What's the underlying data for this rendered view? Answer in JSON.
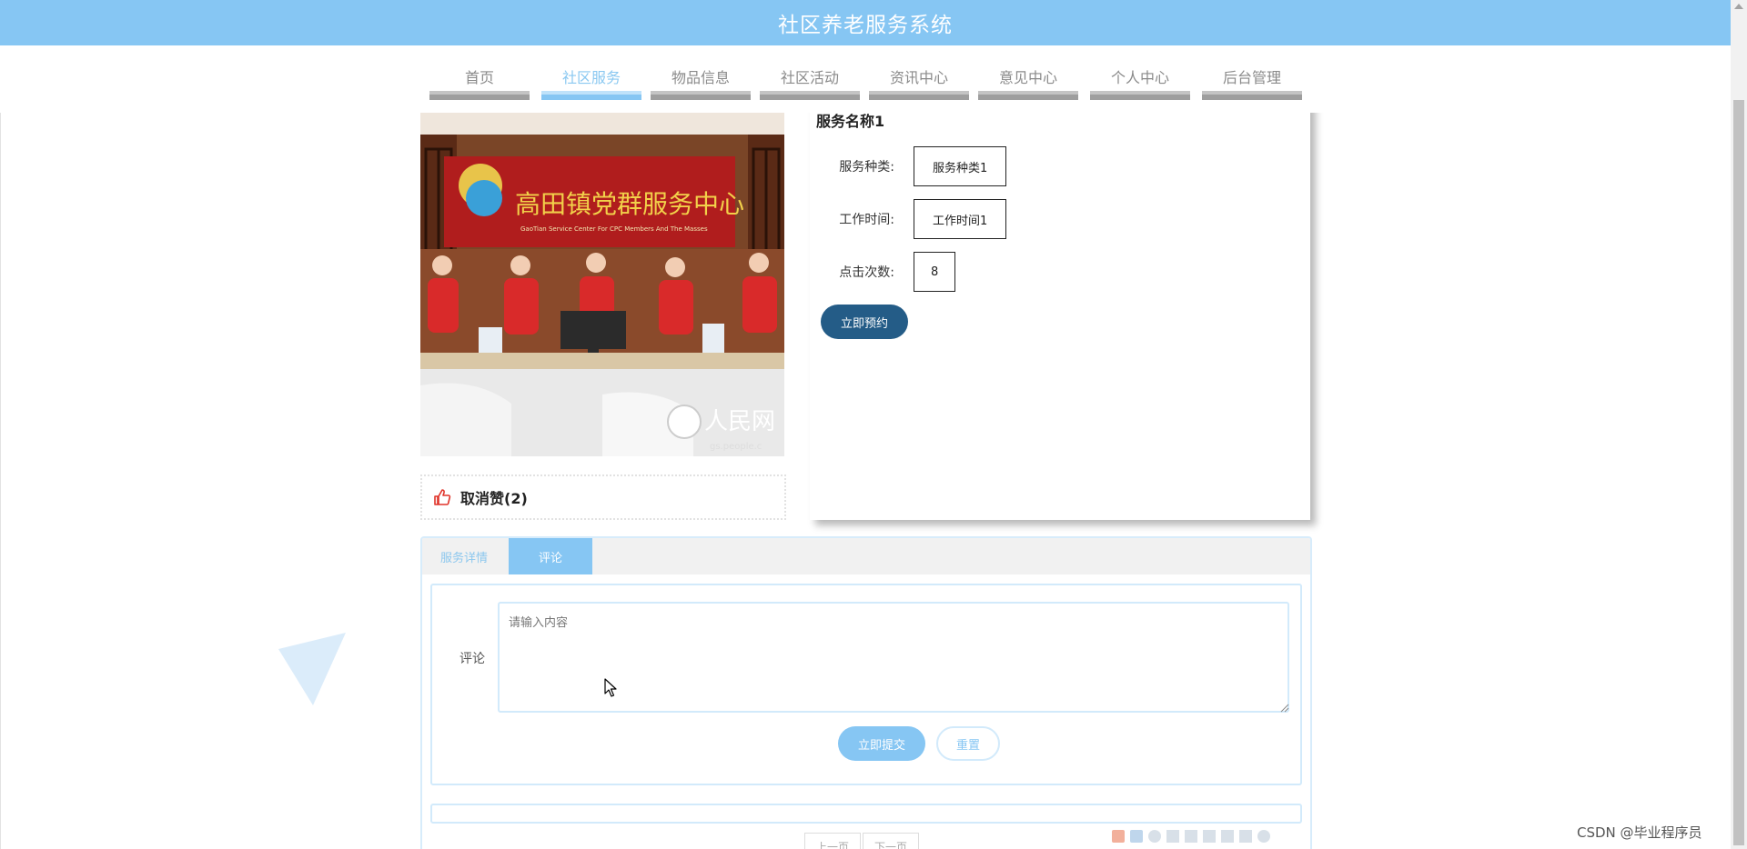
{
  "header": {
    "title": "社区养老服务系统"
  },
  "nav": {
    "items": [
      {
        "label": "首页"
      },
      {
        "label": "社区服务",
        "active": true
      },
      {
        "label": "物品信息"
      },
      {
        "label": "社区活动"
      },
      {
        "label": "资讯中心"
      },
      {
        "label": "意见中心"
      },
      {
        "label": "个人中心"
      },
      {
        "label": "后台管理"
      }
    ]
  },
  "detail": {
    "title": "服务名称1",
    "fields": [
      {
        "label": "服务种类:",
        "value": "服务种类1"
      },
      {
        "label": "工作时间:",
        "value": "工作时间1"
      },
      {
        "label": "点击次数:",
        "value": "8"
      }
    ],
    "book_label": "立即预约"
  },
  "photo": {
    "sign_text": "高田镇党群服务中心",
    "sign_subtext": "GaoTian Service Center For CPC Members And The Masses",
    "watermark_text": "人民网",
    "watermark_sub": "gs.people.c"
  },
  "like": {
    "label": "取消赞(2)"
  },
  "tabs": [
    {
      "label": "服务详情"
    },
    {
      "label": "评论",
      "active": true
    }
  ],
  "comment": {
    "label": "评论",
    "placeholder": "请输入内容",
    "submit_label": "立即提交",
    "reset_label": "重置"
  },
  "pager": {
    "prev_label": "上一页",
    "next_label": "下一页"
  },
  "watermark": "CSDN @毕业程序员",
  "colors": {
    "topbar": "#86c6f3",
    "accent": "#86c6f3",
    "book_button": "#245c87",
    "like_icon": "#e0342a"
  }
}
